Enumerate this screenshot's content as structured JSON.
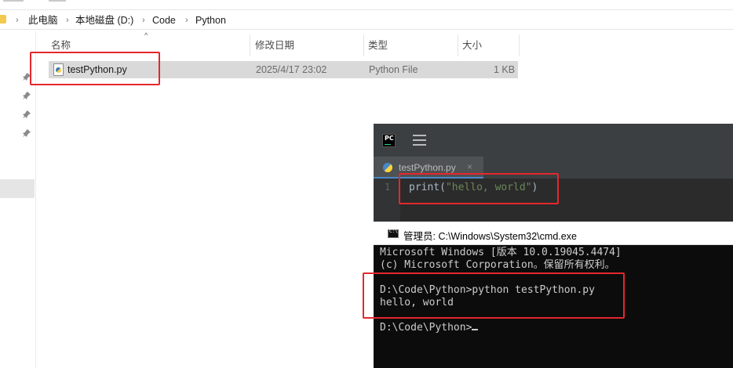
{
  "explorer": {
    "breadcrumb": [
      "此电脑",
      "本地磁盘 (D:)",
      "Code",
      "Python"
    ],
    "columns": [
      "名称",
      "修改日期",
      "类型",
      "大小"
    ],
    "files": [
      {
        "name": "testPython.py",
        "modified": "2025/4/17 23:02",
        "type": "Python File",
        "size": "1 KB"
      }
    ]
  },
  "pycharm": {
    "logo_text": "PC",
    "tab": {
      "label": "testPython.py",
      "close": "×"
    },
    "line_number": "1",
    "code": {
      "fn": "print(",
      "str": "\"hello, world\"",
      "end": ")"
    }
  },
  "cmd": {
    "title": "管理员: C:\\Windows\\System32\\cmd.exe",
    "lines": [
      "Microsoft Windows [版本 10.0.19045.4474]",
      "(c) Microsoft Corporation。保留所有权利。",
      "",
      "D:\\Code\\Python>python testPython.py",
      "hello, world",
      "",
      "D:\\Code\\Python>"
    ]
  },
  "colors": {
    "highlight_box": "#e5272d",
    "pycharm_bg": "#2b2b2b",
    "cmd_bg": "#0c0c0c",
    "string_green": "#6a8759"
  }
}
